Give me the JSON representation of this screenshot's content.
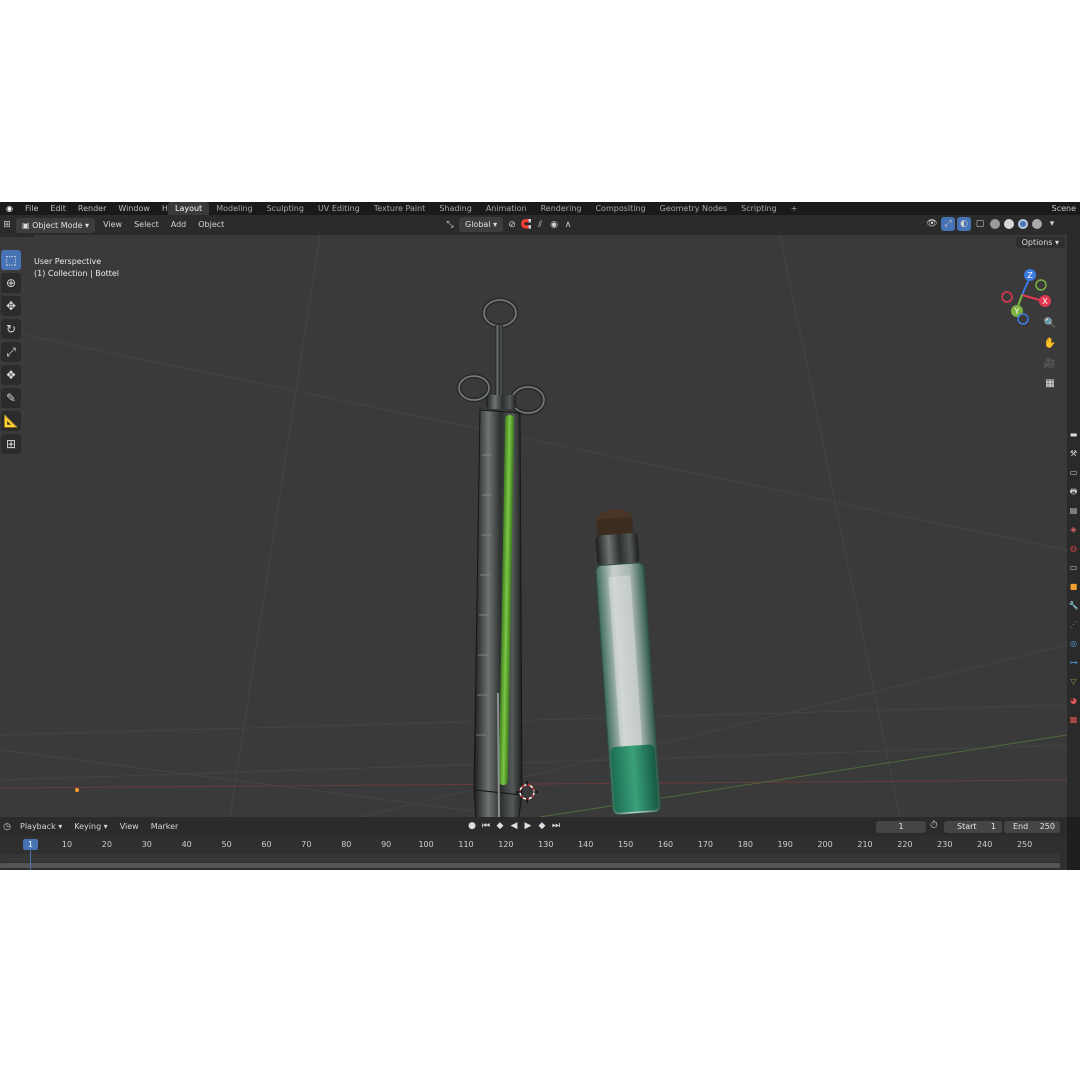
{
  "topbar": {
    "menus": [
      "File",
      "Edit",
      "Render",
      "Window",
      "Help"
    ],
    "workspaces": [
      "Layout",
      "Modeling",
      "Sculpting",
      "UV Editing",
      "Texture Paint",
      "Shading",
      "Animation",
      "Rendering",
      "Compositing",
      "Geometry Nodes",
      "Scripting"
    ],
    "active_workspace": "Layout",
    "add_tab": "+",
    "scene": "Scene"
  },
  "viewport_header": {
    "mode": "Object Mode",
    "menus": [
      "View",
      "Select",
      "Add",
      "Object"
    ],
    "transform_orientation": "Global",
    "options": "Options"
  },
  "viewport": {
    "perspective_label": "User Perspective",
    "collection_label": "(1) Collection | Bottel",
    "gizmo_axes": {
      "x": "X",
      "y": "Y",
      "z": "Z"
    },
    "colors": {
      "x_axis": "#e2384f",
      "y_axis": "#7cb342",
      "z_axis": "#3d7ae3",
      "background": "#3a3a3a",
      "liquid": "#6aa832"
    }
  },
  "toolbar": {
    "tools": [
      "select-box-icon",
      "cursor-icon",
      "move-icon",
      "rotate-icon",
      "scale-icon",
      "transform-icon",
      "annotate-icon",
      "measure-icon",
      "add-cube-icon"
    ]
  },
  "timeline": {
    "menus": [
      "Playback",
      "Keying",
      "View",
      "Marker"
    ],
    "current_frame": "1",
    "start_label": "Start",
    "start_value": "1",
    "end_label": "End",
    "end_value": "250",
    "ruler": [
      "1",
      "10",
      "20",
      "30",
      "40",
      "50",
      "60",
      "70",
      "80",
      "90",
      "100",
      "110",
      "120",
      "130",
      "140",
      "150",
      "160",
      "170",
      "180",
      "190",
      "200",
      "210",
      "220",
      "230",
      "240",
      "250"
    ]
  }
}
